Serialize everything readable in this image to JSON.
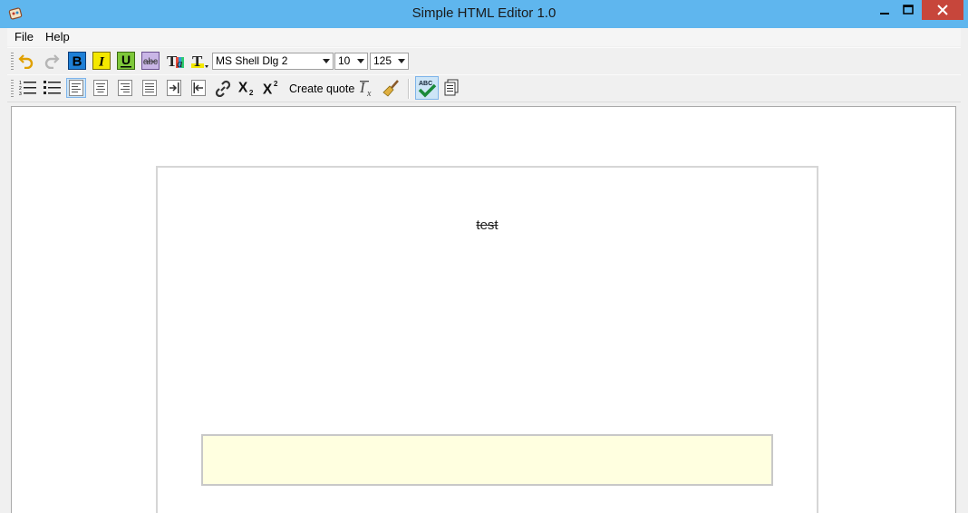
{
  "window": {
    "title": "Simple HTML Editor 1.0"
  },
  "menu": [
    "File",
    "Help"
  ],
  "toolbar1": {
    "font_name": "MS Shell Dlg 2",
    "font_size": "10",
    "zoom": "125"
  },
  "toolbar2": {
    "create_quote_label": "Create quote"
  },
  "document": {
    "text": "test"
  },
  "colors": {
    "titlebar": "#5fb6ee",
    "close": "#c7463b",
    "bold_bg": "#1e7fd6",
    "italic_bg": "#f4e800",
    "note_bg": "#ffffe0"
  }
}
